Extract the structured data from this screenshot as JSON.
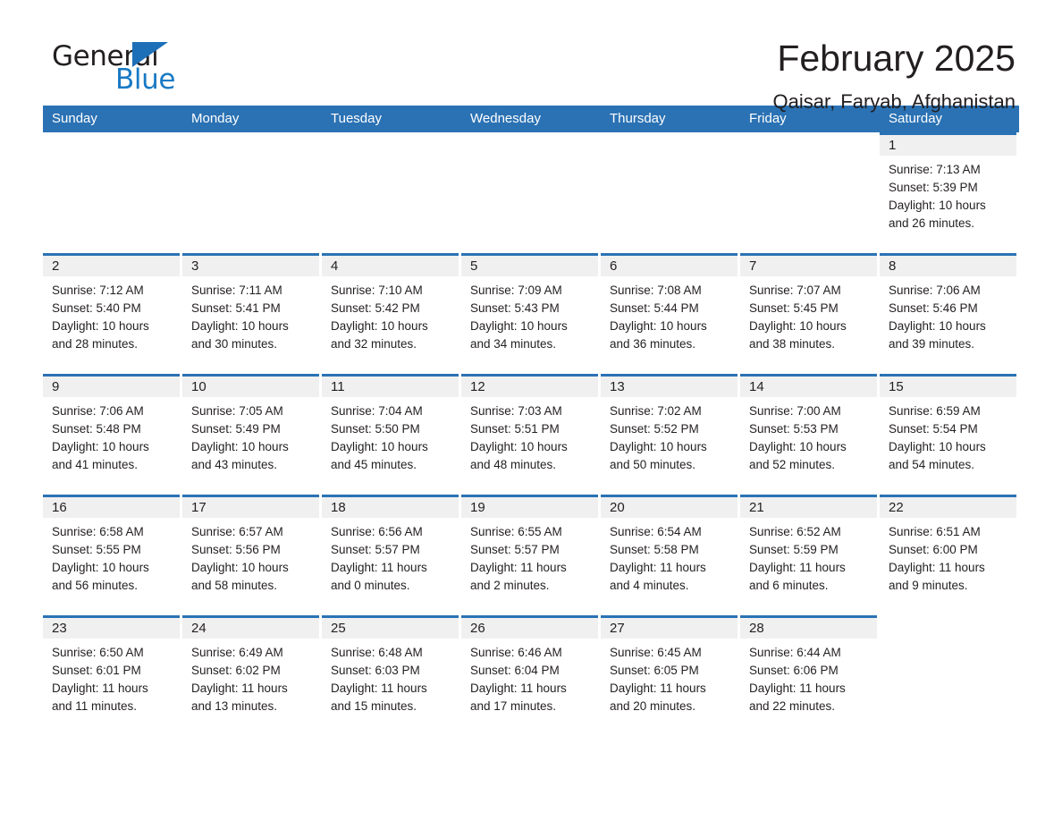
{
  "brand": {
    "name_part1": "General",
    "name_part2": "Blue",
    "flag_icon": "triangle-flag-icon",
    "accent_color": "#1d6fb8"
  },
  "header": {
    "month_title": "February 2025",
    "location": "Qaisar, Faryab, Afghanistan"
  },
  "calendar": {
    "header_bg": "#2b72b4",
    "row_accent": "#2b72b4",
    "daynum_band_bg": "#f0f0f0",
    "weekdays": [
      "Sunday",
      "Monday",
      "Tuesday",
      "Wednesday",
      "Thursday",
      "Friday",
      "Saturday"
    ],
    "weeks": [
      [
        {
          "day": "",
          "filled": false,
          "sunrise": "",
          "sunset": "",
          "daylight_line1": "",
          "daylight_line2": ""
        },
        {
          "day": "",
          "filled": false,
          "sunrise": "",
          "sunset": "",
          "daylight_line1": "",
          "daylight_line2": ""
        },
        {
          "day": "",
          "filled": false,
          "sunrise": "",
          "sunset": "",
          "daylight_line1": "",
          "daylight_line2": ""
        },
        {
          "day": "",
          "filled": false,
          "sunrise": "",
          "sunset": "",
          "daylight_line1": "",
          "daylight_line2": ""
        },
        {
          "day": "",
          "filled": false,
          "sunrise": "",
          "sunset": "",
          "daylight_line1": "",
          "daylight_line2": ""
        },
        {
          "day": "",
          "filled": false,
          "sunrise": "",
          "sunset": "",
          "daylight_line1": "",
          "daylight_line2": ""
        },
        {
          "day": "1",
          "filled": true,
          "sunrise": "Sunrise: 7:13 AM",
          "sunset": "Sunset: 5:39 PM",
          "daylight_line1": "Daylight: 10 hours",
          "daylight_line2": "and 26 minutes."
        }
      ],
      [
        {
          "day": "2",
          "filled": true,
          "sunrise": "Sunrise: 7:12 AM",
          "sunset": "Sunset: 5:40 PM",
          "daylight_line1": "Daylight: 10 hours",
          "daylight_line2": "and 28 minutes."
        },
        {
          "day": "3",
          "filled": true,
          "sunrise": "Sunrise: 7:11 AM",
          "sunset": "Sunset: 5:41 PM",
          "daylight_line1": "Daylight: 10 hours",
          "daylight_line2": "and 30 minutes."
        },
        {
          "day": "4",
          "filled": true,
          "sunrise": "Sunrise: 7:10 AM",
          "sunset": "Sunset: 5:42 PM",
          "daylight_line1": "Daylight: 10 hours",
          "daylight_line2": "and 32 minutes."
        },
        {
          "day": "5",
          "filled": true,
          "sunrise": "Sunrise: 7:09 AM",
          "sunset": "Sunset: 5:43 PM",
          "daylight_line1": "Daylight: 10 hours",
          "daylight_line2": "and 34 minutes."
        },
        {
          "day": "6",
          "filled": true,
          "sunrise": "Sunrise: 7:08 AM",
          "sunset": "Sunset: 5:44 PM",
          "daylight_line1": "Daylight: 10 hours",
          "daylight_line2": "and 36 minutes."
        },
        {
          "day": "7",
          "filled": true,
          "sunrise": "Sunrise: 7:07 AM",
          "sunset": "Sunset: 5:45 PM",
          "daylight_line1": "Daylight: 10 hours",
          "daylight_line2": "and 38 minutes."
        },
        {
          "day": "8",
          "filled": true,
          "sunrise": "Sunrise: 7:06 AM",
          "sunset": "Sunset: 5:46 PM",
          "daylight_line1": "Daylight: 10 hours",
          "daylight_line2": "and 39 minutes."
        }
      ],
      [
        {
          "day": "9",
          "filled": true,
          "sunrise": "Sunrise: 7:06 AM",
          "sunset": "Sunset: 5:48 PM",
          "daylight_line1": "Daylight: 10 hours",
          "daylight_line2": "and 41 minutes."
        },
        {
          "day": "10",
          "filled": true,
          "sunrise": "Sunrise: 7:05 AM",
          "sunset": "Sunset: 5:49 PM",
          "daylight_line1": "Daylight: 10 hours",
          "daylight_line2": "and 43 minutes."
        },
        {
          "day": "11",
          "filled": true,
          "sunrise": "Sunrise: 7:04 AM",
          "sunset": "Sunset: 5:50 PM",
          "daylight_line1": "Daylight: 10 hours",
          "daylight_line2": "and 45 minutes."
        },
        {
          "day": "12",
          "filled": true,
          "sunrise": "Sunrise: 7:03 AM",
          "sunset": "Sunset: 5:51 PM",
          "daylight_line1": "Daylight: 10 hours",
          "daylight_line2": "and 48 minutes."
        },
        {
          "day": "13",
          "filled": true,
          "sunrise": "Sunrise: 7:02 AM",
          "sunset": "Sunset: 5:52 PM",
          "daylight_line1": "Daylight: 10 hours",
          "daylight_line2": "and 50 minutes."
        },
        {
          "day": "14",
          "filled": true,
          "sunrise": "Sunrise: 7:00 AM",
          "sunset": "Sunset: 5:53 PM",
          "daylight_line1": "Daylight: 10 hours",
          "daylight_line2": "and 52 minutes."
        },
        {
          "day": "15",
          "filled": true,
          "sunrise": "Sunrise: 6:59 AM",
          "sunset": "Sunset: 5:54 PM",
          "daylight_line1": "Daylight: 10 hours",
          "daylight_line2": "and 54 minutes."
        }
      ],
      [
        {
          "day": "16",
          "filled": true,
          "sunrise": "Sunrise: 6:58 AM",
          "sunset": "Sunset: 5:55 PM",
          "daylight_line1": "Daylight: 10 hours",
          "daylight_line2": "and 56 minutes."
        },
        {
          "day": "17",
          "filled": true,
          "sunrise": "Sunrise: 6:57 AM",
          "sunset": "Sunset: 5:56 PM",
          "daylight_line1": "Daylight: 10 hours",
          "daylight_line2": "and 58 minutes."
        },
        {
          "day": "18",
          "filled": true,
          "sunrise": "Sunrise: 6:56 AM",
          "sunset": "Sunset: 5:57 PM",
          "daylight_line1": "Daylight: 11 hours",
          "daylight_line2": "and 0 minutes."
        },
        {
          "day": "19",
          "filled": true,
          "sunrise": "Sunrise: 6:55 AM",
          "sunset": "Sunset: 5:57 PM",
          "daylight_line1": "Daylight: 11 hours",
          "daylight_line2": "and 2 minutes."
        },
        {
          "day": "20",
          "filled": true,
          "sunrise": "Sunrise: 6:54 AM",
          "sunset": "Sunset: 5:58 PM",
          "daylight_line1": "Daylight: 11 hours",
          "daylight_line2": "and 4 minutes."
        },
        {
          "day": "21",
          "filled": true,
          "sunrise": "Sunrise: 6:52 AM",
          "sunset": "Sunset: 5:59 PM",
          "daylight_line1": "Daylight: 11 hours",
          "daylight_line2": "and 6 minutes."
        },
        {
          "day": "22",
          "filled": true,
          "sunrise": "Sunrise: 6:51 AM",
          "sunset": "Sunset: 6:00 PM",
          "daylight_line1": "Daylight: 11 hours",
          "daylight_line2": "and 9 minutes."
        }
      ],
      [
        {
          "day": "23",
          "filled": true,
          "sunrise": "Sunrise: 6:50 AM",
          "sunset": "Sunset: 6:01 PM",
          "daylight_line1": "Daylight: 11 hours",
          "daylight_line2": "and 11 minutes."
        },
        {
          "day": "24",
          "filled": true,
          "sunrise": "Sunrise: 6:49 AM",
          "sunset": "Sunset: 6:02 PM",
          "daylight_line1": "Daylight: 11 hours",
          "daylight_line2": "and 13 minutes."
        },
        {
          "day": "25",
          "filled": true,
          "sunrise": "Sunrise: 6:48 AM",
          "sunset": "Sunset: 6:03 PM",
          "daylight_line1": "Daylight: 11 hours",
          "daylight_line2": "and 15 minutes."
        },
        {
          "day": "26",
          "filled": true,
          "sunrise": "Sunrise: 6:46 AM",
          "sunset": "Sunset: 6:04 PM",
          "daylight_line1": "Daylight: 11 hours",
          "daylight_line2": "and 17 minutes."
        },
        {
          "day": "27",
          "filled": true,
          "sunrise": "Sunrise: 6:45 AM",
          "sunset": "Sunset: 6:05 PM",
          "daylight_line1": "Daylight: 11 hours",
          "daylight_line2": "and 20 minutes."
        },
        {
          "day": "28",
          "filled": true,
          "sunrise": "Sunrise: 6:44 AM",
          "sunset": "Sunset: 6:06 PM",
          "daylight_line1": "Daylight: 11 hours",
          "daylight_line2": "and 22 minutes."
        },
        {
          "day": "",
          "filled": false,
          "sunrise": "",
          "sunset": "",
          "daylight_line1": "",
          "daylight_line2": ""
        }
      ]
    ]
  }
}
